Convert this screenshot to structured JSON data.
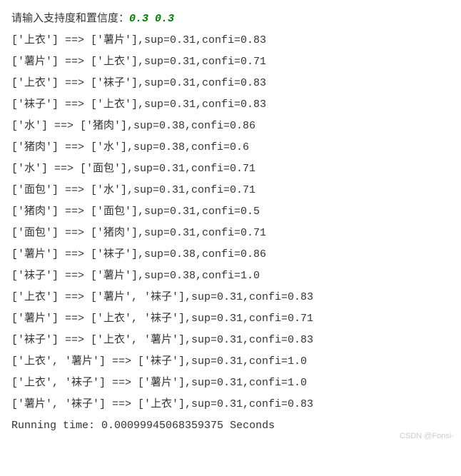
{
  "prompt": {
    "label": "请输入支持度和置信度：",
    "input": "0.3 0.3"
  },
  "rules": [
    {
      "lhs": "['上衣']",
      "rhs": "['薯片']",
      "sup": "0.31",
      "confi": "0.83"
    },
    {
      "lhs": "['薯片']",
      "rhs": "['上衣']",
      "sup": "0.31",
      "confi": "0.71"
    },
    {
      "lhs": "['上衣']",
      "rhs": "['袜子']",
      "sup": "0.31",
      "confi": "0.83"
    },
    {
      "lhs": "['袜子']",
      "rhs": "['上衣']",
      "sup": "0.31",
      "confi": "0.83"
    },
    {
      "lhs": "['水']",
      "rhs": "['猪肉']",
      "sup": "0.38",
      "confi": "0.86"
    },
    {
      "lhs": "['猪肉']",
      "rhs": "['水']",
      "sup": "0.38",
      "confi": "0.6"
    },
    {
      "lhs": "['水']",
      "rhs": "['面包']",
      "sup": "0.31",
      "confi": "0.71"
    },
    {
      "lhs": "['面包']",
      "rhs": "['水']",
      "sup": "0.31",
      "confi": "0.71"
    },
    {
      "lhs": "['猪肉']",
      "rhs": "['面包']",
      "sup": "0.31",
      "confi": "0.5"
    },
    {
      "lhs": "['面包']",
      "rhs": "['猪肉']",
      "sup": "0.31",
      "confi": "0.71"
    },
    {
      "lhs": "['薯片']",
      "rhs": "['袜子']",
      "sup": "0.38",
      "confi": "0.86"
    },
    {
      "lhs": "['袜子']",
      "rhs": "['薯片']",
      "sup": "0.38",
      "confi": "1.0"
    },
    {
      "lhs": "['上衣']",
      "rhs": "['薯片', '袜子']",
      "sup": "0.31",
      "confi": "0.83"
    },
    {
      "lhs": "['薯片']",
      "rhs": "['上衣', '袜子']",
      "sup": "0.31",
      "confi": "0.71"
    },
    {
      "lhs": "['袜子']",
      "rhs": "['上衣', '薯片']",
      "sup": "0.31",
      "confi": "0.83"
    },
    {
      "lhs": "['上衣', '薯片']",
      "rhs": "['袜子']",
      "sup": "0.31",
      "confi": "1.0"
    },
    {
      "lhs": "['上衣', '袜子']",
      "rhs": "['薯片']",
      "sup": "0.31",
      "confi": "1.0"
    },
    {
      "lhs": "['薯片', '袜子']",
      "rhs": "['上衣']",
      "sup": "0.31",
      "confi": "0.83"
    }
  ],
  "running_time": {
    "prefix": "Running time: ",
    "value": "0.00099945068359375",
    "suffix": " Seconds"
  },
  "watermark": "CSDN @Fonsi-"
}
